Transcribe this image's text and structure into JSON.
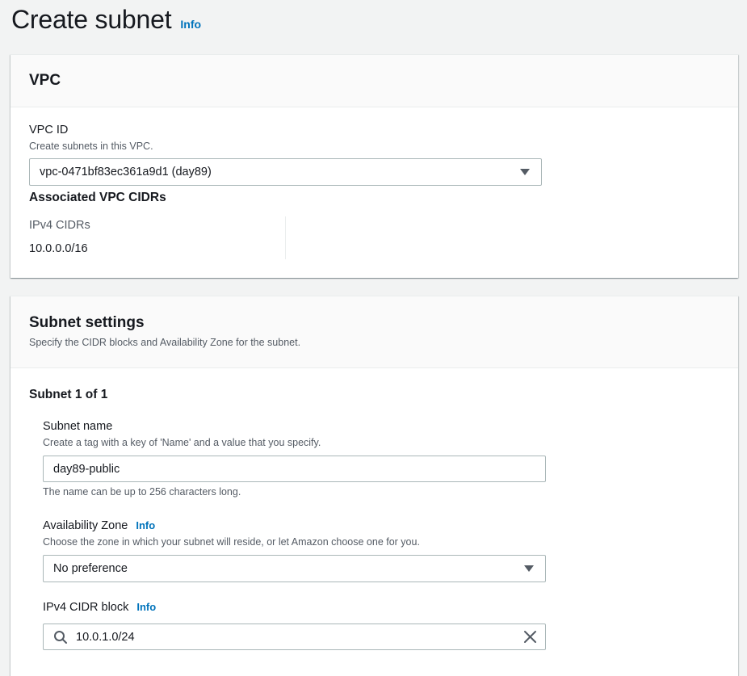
{
  "page": {
    "title": "Create subnet",
    "info_label": "Info"
  },
  "vpc_panel": {
    "title": "VPC",
    "vpc_id_label": "VPC ID",
    "vpc_id_desc": "Create subnets in this VPC.",
    "vpc_id_value": "vpc-0471bf83ec361a9d1 (day89)",
    "associated_title": "Associated VPC CIDRs",
    "ipv4_cidrs_label": "IPv4 CIDRs",
    "ipv4_cidrs_value": "10.0.0.0/16"
  },
  "subnet_panel": {
    "title": "Subnet settings",
    "desc": "Specify the CIDR blocks and Availability Zone for the subnet.",
    "subnet_count": "Subnet 1 of 1",
    "name_label": "Subnet name",
    "name_desc": "Create a tag with a key of 'Name' and a value that you specify.",
    "name_value": "day89-public",
    "name_constraint": "The name can be up to 256 characters long.",
    "az_label": "Availability Zone",
    "az_info": "Info",
    "az_desc": "Choose the zone in which your subnet will reside, or let Amazon choose one for you.",
    "az_value": "No preference",
    "cidr_label": "IPv4 CIDR block",
    "cidr_info": "Info",
    "cidr_value": "10.0.1.0/24"
  },
  "icons": {
    "dropdown": "caret-down-icon",
    "search": "search-icon",
    "clear": "close-icon"
  },
  "colors": {
    "link": "#0073bb",
    "background": "#f2f3f3",
    "panel_header": "#fafafa"
  }
}
